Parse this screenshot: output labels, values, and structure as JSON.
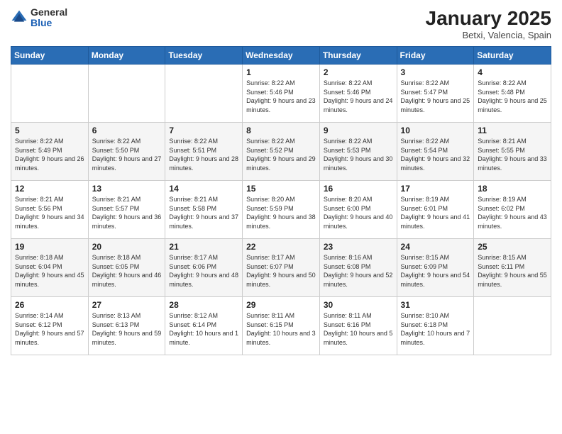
{
  "logo": {
    "general": "General",
    "blue": "Blue"
  },
  "header": {
    "title": "January 2025",
    "location": "Betxi, Valencia, Spain"
  },
  "days_of_week": [
    "Sunday",
    "Monday",
    "Tuesday",
    "Wednesday",
    "Thursday",
    "Friday",
    "Saturday"
  ],
  "weeks": [
    [
      {
        "day": "",
        "text": ""
      },
      {
        "day": "",
        "text": ""
      },
      {
        "day": "",
        "text": ""
      },
      {
        "day": "1",
        "text": "Sunrise: 8:22 AM\nSunset: 5:46 PM\nDaylight: 9 hours and 23 minutes."
      },
      {
        "day": "2",
        "text": "Sunrise: 8:22 AM\nSunset: 5:46 PM\nDaylight: 9 hours and 24 minutes."
      },
      {
        "day": "3",
        "text": "Sunrise: 8:22 AM\nSunset: 5:47 PM\nDaylight: 9 hours and 25 minutes."
      },
      {
        "day": "4",
        "text": "Sunrise: 8:22 AM\nSunset: 5:48 PM\nDaylight: 9 hours and 25 minutes."
      }
    ],
    [
      {
        "day": "5",
        "text": "Sunrise: 8:22 AM\nSunset: 5:49 PM\nDaylight: 9 hours and 26 minutes."
      },
      {
        "day": "6",
        "text": "Sunrise: 8:22 AM\nSunset: 5:50 PM\nDaylight: 9 hours and 27 minutes."
      },
      {
        "day": "7",
        "text": "Sunrise: 8:22 AM\nSunset: 5:51 PM\nDaylight: 9 hours and 28 minutes."
      },
      {
        "day": "8",
        "text": "Sunrise: 8:22 AM\nSunset: 5:52 PM\nDaylight: 9 hours and 29 minutes."
      },
      {
        "day": "9",
        "text": "Sunrise: 8:22 AM\nSunset: 5:53 PM\nDaylight: 9 hours and 30 minutes."
      },
      {
        "day": "10",
        "text": "Sunrise: 8:22 AM\nSunset: 5:54 PM\nDaylight: 9 hours and 32 minutes."
      },
      {
        "day": "11",
        "text": "Sunrise: 8:21 AM\nSunset: 5:55 PM\nDaylight: 9 hours and 33 minutes."
      }
    ],
    [
      {
        "day": "12",
        "text": "Sunrise: 8:21 AM\nSunset: 5:56 PM\nDaylight: 9 hours and 34 minutes."
      },
      {
        "day": "13",
        "text": "Sunrise: 8:21 AM\nSunset: 5:57 PM\nDaylight: 9 hours and 36 minutes."
      },
      {
        "day": "14",
        "text": "Sunrise: 8:21 AM\nSunset: 5:58 PM\nDaylight: 9 hours and 37 minutes."
      },
      {
        "day": "15",
        "text": "Sunrise: 8:20 AM\nSunset: 5:59 PM\nDaylight: 9 hours and 38 minutes."
      },
      {
        "day": "16",
        "text": "Sunrise: 8:20 AM\nSunset: 6:00 PM\nDaylight: 9 hours and 40 minutes."
      },
      {
        "day": "17",
        "text": "Sunrise: 8:19 AM\nSunset: 6:01 PM\nDaylight: 9 hours and 41 minutes."
      },
      {
        "day": "18",
        "text": "Sunrise: 8:19 AM\nSunset: 6:02 PM\nDaylight: 9 hours and 43 minutes."
      }
    ],
    [
      {
        "day": "19",
        "text": "Sunrise: 8:18 AM\nSunset: 6:04 PM\nDaylight: 9 hours and 45 minutes."
      },
      {
        "day": "20",
        "text": "Sunrise: 8:18 AM\nSunset: 6:05 PM\nDaylight: 9 hours and 46 minutes."
      },
      {
        "day": "21",
        "text": "Sunrise: 8:17 AM\nSunset: 6:06 PM\nDaylight: 9 hours and 48 minutes."
      },
      {
        "day": "22",
        "text": "Sunrise: 8:17 AM\nSunset: 6:07 PM\nDaylight: 9 hours and 50 minutes."
      },
      {
        "day": "23",
        "text": "Sunrise: 8:16 AM\nSunset: 6:08 PM\nDaylight: 9 hours and 52 minutes."
      },
      {
        "day": "24",
        "text": "Sunrise: 8:15 AM\nSunset: 6:09 PM\nDaylight: 9 hours and 54 minutes."
      },
      {
        "day": "25",
        "text": "Sunrise: 8:15 AM\nSunset: 6:11 PM\nDaylight: 9 hours and 55 minutes."
      }
    ],
    [
      {
        "day": "26",
        "text": "Sunrise: 8:14 AM\nSunset: 6:12 PM\nDaylight: 9 hours and 57 minutes."
      },
      {
        "day": "27",
        "text": "Sunrise: 8:13 AM\nSunset: 6:13 PM\nDaylight: 9 hours and 59 minutes."
      },
      {
        "day": "28",
        "text": "Sunrise: 8:12 AM\nSunset: 6:14 PM\nDaylight: 10 hours and 1 minute."
      },
      {
        "day": "29",
        "text": "Sunrise: 8:11 AM\nSunset: 6:15 PM\nDaylight: 10 hours and 3 minutes."
      },
      {
        "day": "30",
        "text": "Sunrise: 8:11 AM\nSunset: 6:16 PM\nDaylight: 10 hours and 5 minutes."
      },
      {
        "day": "31",
        "text": "Sunrise: 8:10 AM\nSunset: 6:18 PM\nDaylight: 10 hours and 7 minutes."
      },
      {
        "day": "",
        "text": ""
      }
    ]
  ]
}
